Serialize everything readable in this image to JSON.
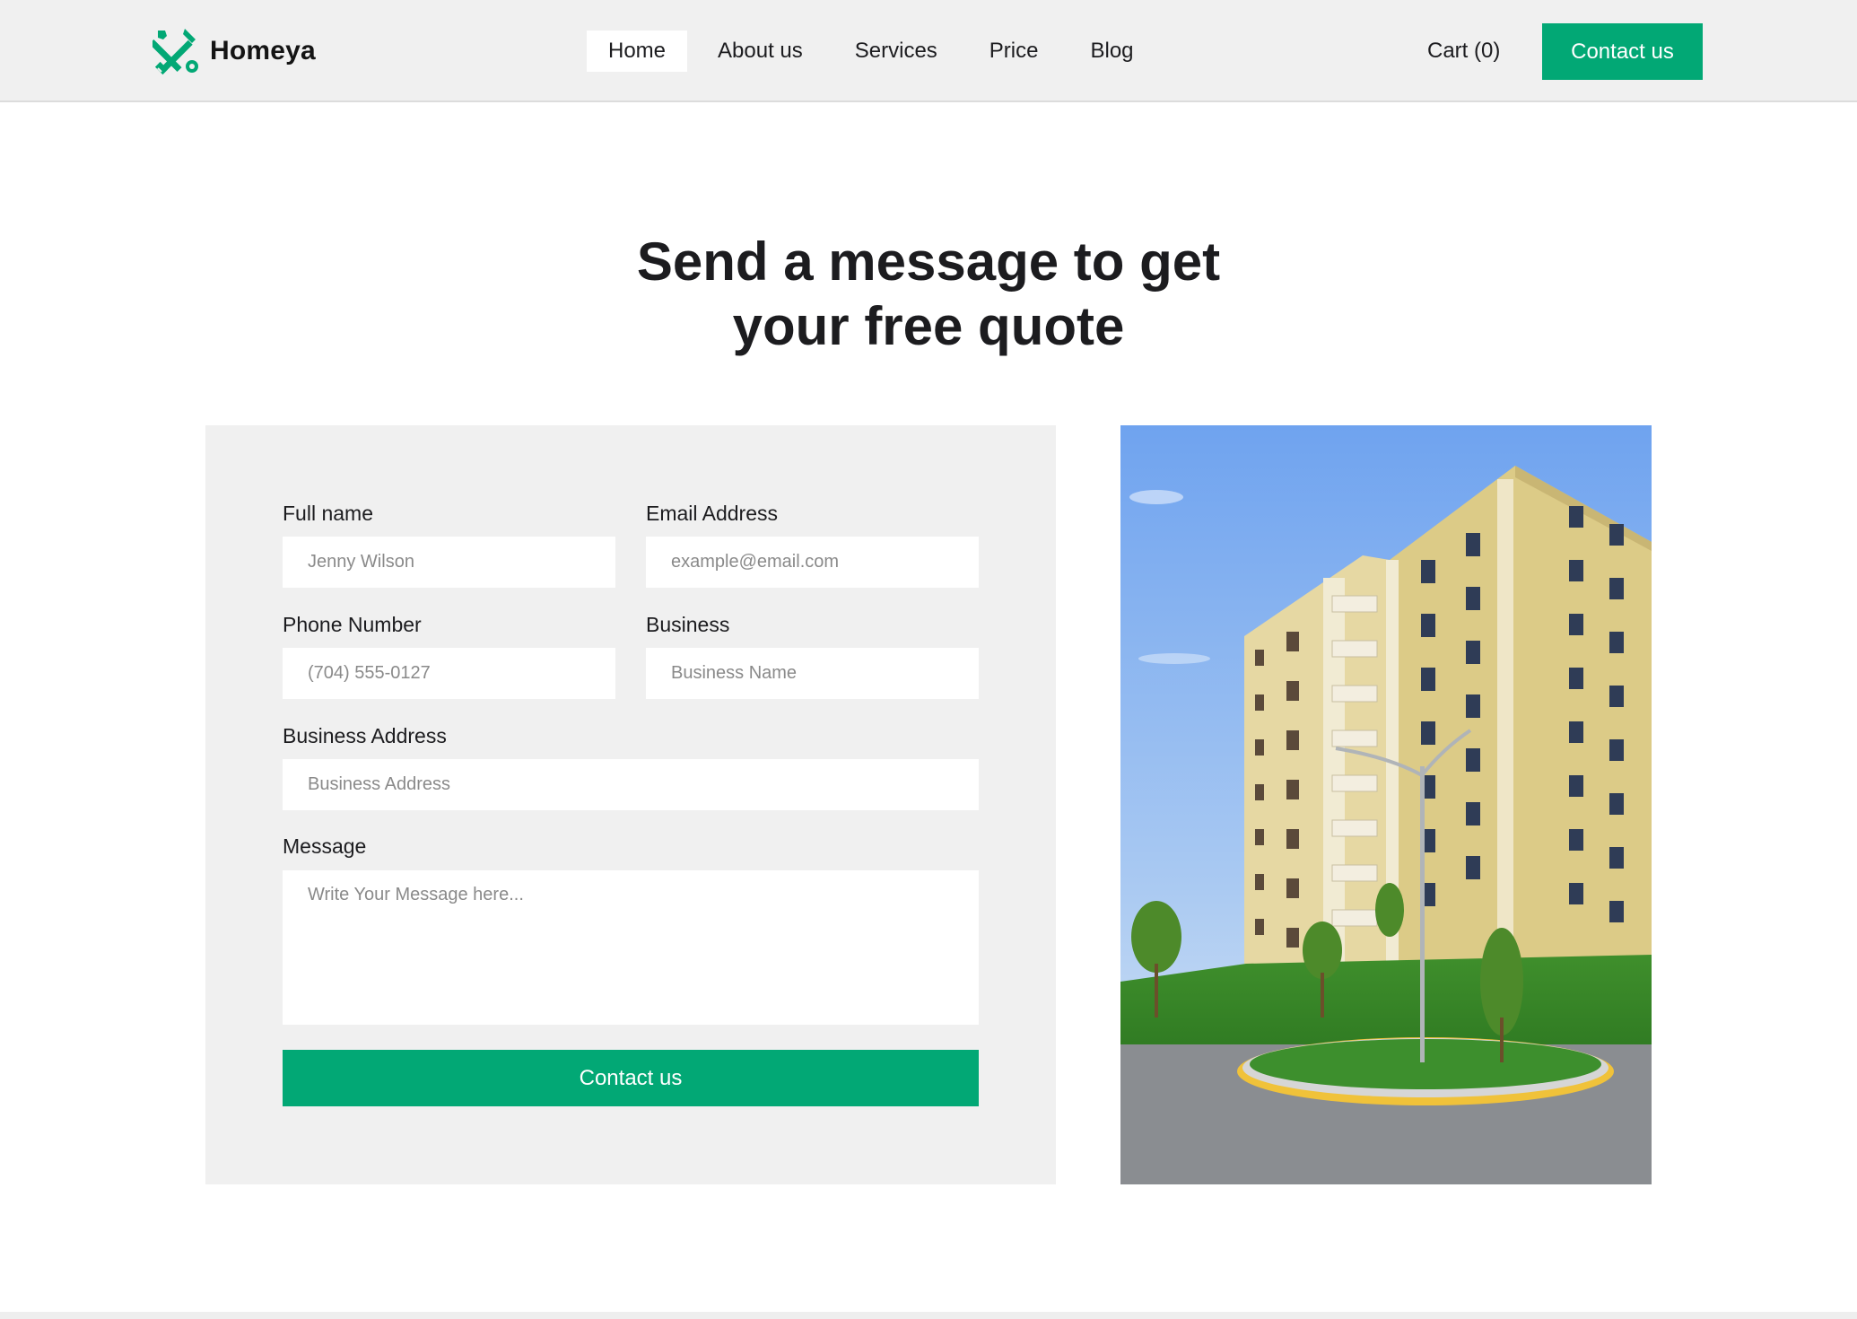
{
  "brand": {
    "name": "Homeya",
    "accent_color": "#02a875",
    "logo_icon": "hammer-wrench-icon"
  },
  "nav": {
    "items": [
      {
        "label": "Home",
        "active": true
      },
      {
        "label": "About us",
        "active": false
      },
      {
        "label": "Services",
        "active": false
      },
      {
        "label": "Price",
        "active": false
      },
      {
        "label": "Blog",
        "active": false
      }
    ],
    "cart_label": "Cart (0)",
    "contact_label": "Contact us"
  },
  "hero": {
    "title_line1": "Send a message to get",
    "title_line2": "your free quote"
  },
  "form": {
    "full_name": {
      "label": "Full name",
      "placeholder": "Jenny Wilson"
    },
    "email": {
      "label": "Email Address",
      "placeholder": "example@email.com"
    },
    "phone": {
      "label": "Phone Number",
      "placeholder": "(704) 555-0127"
    },
    "business": {
      "label": "Business",
      "placeholder": "Business Name"
    },
    "business_address": {
      "label": "Business Address",
      "placeholder": "Business Address"
    },
    "message": {
      "label": "Message",
      "placeholder": "Write Your Message here..."
    },
    "submit_label": "Contact us"
  }
}
